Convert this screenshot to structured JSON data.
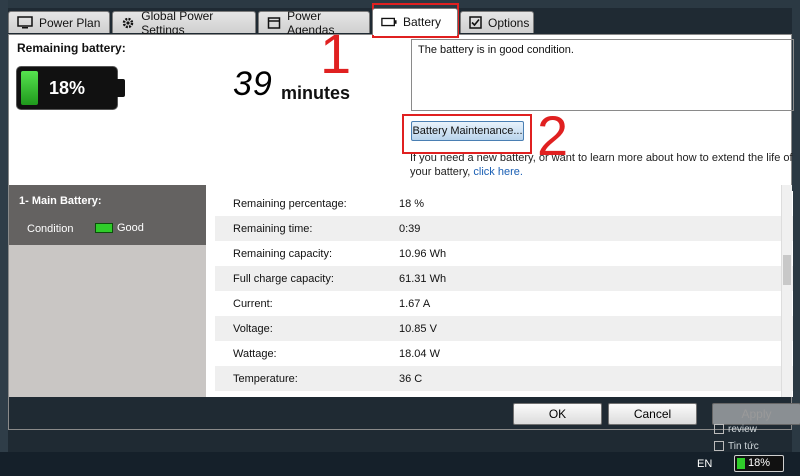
{
  "tabs": [
    {
      "label": "Power Plan",
      "icon": "monitor-icon"
    },
    {
      "label": "Global Power Settings",
      "icon": "gear-icon"
    },
    {
      "label": "Power Agendas",
      "icon": "power-agenda-icon"
    },
    {
      "label": "Battery",
      "icon": "battery-icon"
    },
    {
      "label": "Options",
      "icon": "checkbox-icon"
    }
  ],
  "active_tab": "Battery",
  "summary": {
    "remaining_label": "Remaining battery:",
    "percent_text": "18%",
    "percent_value": 0.18,
    "time_value": "39",
    "time_unit": "minutes"
  },
  "status": {
    "message": "The battery is in good condition."
  },
  "maintenance_button": "Battery Maintenance...",
  "help": {
    "text": "If you need a new battery, or want to learn more about how to extend the life of your battery,",
    "link": "click here."
  },
  "annotations": {
    "n1": "1",
    "n2": "2"
  },
  "battery_list": {
    "title": "1- Main Battery:",
    "condition_label": "Condition",
    "condition_value": "Good"
  },
  "details": [
    {
      "label": "Remaining percentage:",
      "value": "18 %"
    },
    {
      "label": "Remaining time:",
      "value": "0:39"
    },
    {
      "label": "Remaining capacity:",
      "value": "10.96 Wh"
    },
    {
      "label": "Full charge capacity:",
      "value": "61.31 Wh"
    },
    {
      "label": "Current:",
      "value": "1.67 A"
    },
    {
      "label": "Voltage:",
      "value": "10.85 V"
    },
    {
      "label": "Wattage:",
      "value": "18.04 W"
    },
    {
      "label": "Temperature:",
      "value": "36 C"
    }
  ],
  "buttons": {
    "ok": "OK",
    "cancel": "Cancel",
    "apply": "Apply"
  },
  "background": {
    "item1": "review",
    "item2": "Tin tức"
  },
  "taskbar": {
    "lang": "EN",
    "battery": "18%",
    "battery_value": 0.18
  },
  "colors": {
    "annotation": "#e02020",
    "battery_green": "#2fcc2a",
    "link": "#1a5fb4"
  }
}
